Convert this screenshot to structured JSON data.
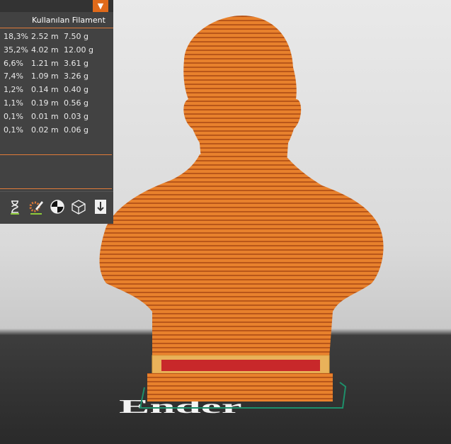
{
  "panel": {
    "header_label": "Kullanılan Filament",
    "dropdown_icon": "chevron-down-icon",
    "rows": [
      {
        "pct": "18,3%",
        "length": "2.52 m",
        "weight": "7.50 g"
      },
      {
        "pct": "35,2%",
        "length": "4.02 m",
        "weight": "12.00 g"
      },
      {
        "pct": "6,6%",
        "length": "1.21 m",
        "weight": "3.61 g"
      },
      {
        "pct": "7,4%",
        "length": "1.09 m",
        "weight": "3.26 g"
      },
      {
        "pct": "1,2%",
        "length": "0.14 m",
        "weight": "0.40 g"
      },
      {
        "pct": "1,1%",
        "length": "0.19 m",
        "weight": "0.56 g"
      },
      {
        "pct": "0,1%",
        "length": "0.01 m",
        "weight": "0.03 g"
      },
      {
        "pct": "0,1%",
        "length": "0.02 m",
        "weight": "0.06 g"
      }
    ],
    "toolbar_icons": [
      "hourglass-icon",
      "pencil-gear-icon",
      "half-circle-icon",
      "cube-icon",
      "export-icon"
    ]
  },
  "viewport": {
    "model": "bust",
    "model_color": "#e8812c",
    "bed_logo_text": "Ender"
  }
}
